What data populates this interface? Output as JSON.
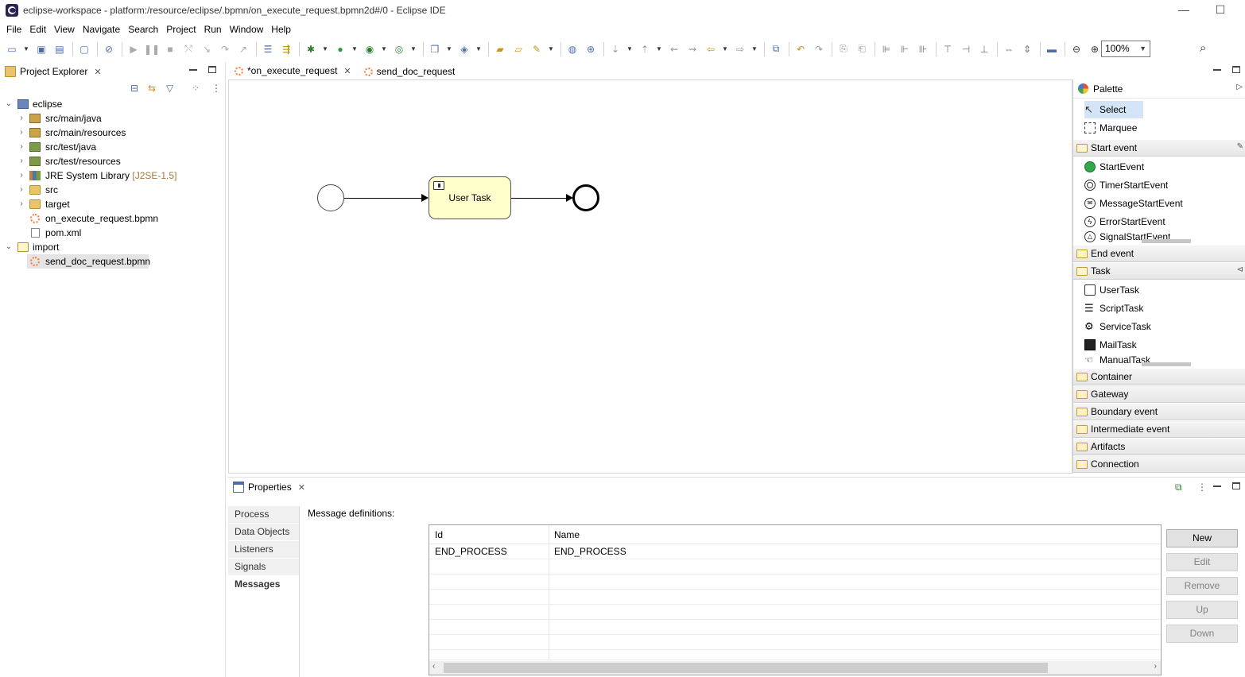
{
  "window": {
    "title": "eclipse-workspace - platform:/resource/eclipse/.bpmn/on_execute_request.bpmn2d#/0 - Eclipse IDE",
    "minimize": "—",
    "maximize": "☐"
  },
  "menu": [
    "File",
    "Edit",
    "View",
    "Navigate",
    "Search",
    "Project",
    "Run",
    "Window",
    "Help"
  ],
  "toolbar": {
    "zoom": "100%"
  },
  "explorer": {
    "title": "Project Explorer",
    "tree": [
      {
        "label": "eclipse",
        "twisty": "⌄",
        "level": 0
      },
      {
        "label": "src/main/java",
        "twisty": "›",
        "level": 1
      },
      {
        "label": "src/main/resources",
        "twisty": "›",
        "level": 1
      },
      {
        "label": "src/test/java",
        "twisty": "›",
        "level": 1
      },
      {
        "label": "src/test/resources",
        "twisty": "›",
        "level": 1
      },
      {
        "label": "JRE System Library",
        "deco": "[J2SE-1.5]",
        "twisty": "›",
        "level": 1
      },
      {
        "label": "src",
        "twisty": "›",
        "level": 1
      },
      {
        "label": "target",
        "twisty": "›",
        "level": 1
      },
      {
        "label": "on_execute_request.bpmn",
        "level": 1
      },
      {
        "label": "pom.xml",
        "level": 1
      },
      {
        "label": "import",
        "twisty": "⌄",
        "level": 0
      },
      {
        "label": "send_doc_request.bpmn",
        "level": 1,
        "selected": true
      }
    ]
  },
  "editor": {
    "tabs": [
      {
        "label": "*on_execute_request",
        "active": true
      },
      {
        "label": "send_doc_request",
        "active": false
      }
    ],
    "diagram": {
      "task_label": "User Task"
    }
  },
  "palette": {
    "title": "Palette",
    "tools": [
      "Select",
      "Marquee"
    ],
    "start_event": {
      "label": "Start event",
      "items": [
        "StartEvent",
        "TimerStartEvent",
        "MessageStartEvent",
        "ErrorStartEvent",
        "SignalStartEvent"
      ]
    },
    "end_event": "End event",
    "task": {
      "label": "Task",
      "items": [
        "UserTask",
        "ScriptTask",
        "ServiceTask",
        "MailTask",
        "ManualTask"
      ]
    },
    "drawers": [
      "Container",
      "Gateway",
      "Boundary event",
      "Intermediate event",
      "Artifacts",
      "Connection"
    ]
  },
  "properties": {
    "title": "Properties",
    "tabs": [
      "Process",
      "Data Objects",
      "Listeners",
      "Signals",
      "Messages"
    ],
    "active_tab": "Messages",
    "section_label": "Message definitions:",
    "table": {
      "columns": [
        "Id",
        "Name"
      ],
      "rows": [
        [
          "END_PROCESS",
          "END_PROCESS"
        ]
      ]
    },
    "buttons": [
      {
        "label": "New",
        "enabled": true
      },
      {
        "label": "Edit",
        "enabled": false
      },
      {
        "label": "Remove",
        "enabled": false
      },
      {
        "label": "Up",
        "enabled": false
      },
      {
        "label": "Down",
        "enabled": false
      }
    ]
  },
  "colors": {
    "task_fill": "#ffffcc",
    "selection": "#d4e4f7",
    "start_event_green": "#2ea84a"
  }
}
